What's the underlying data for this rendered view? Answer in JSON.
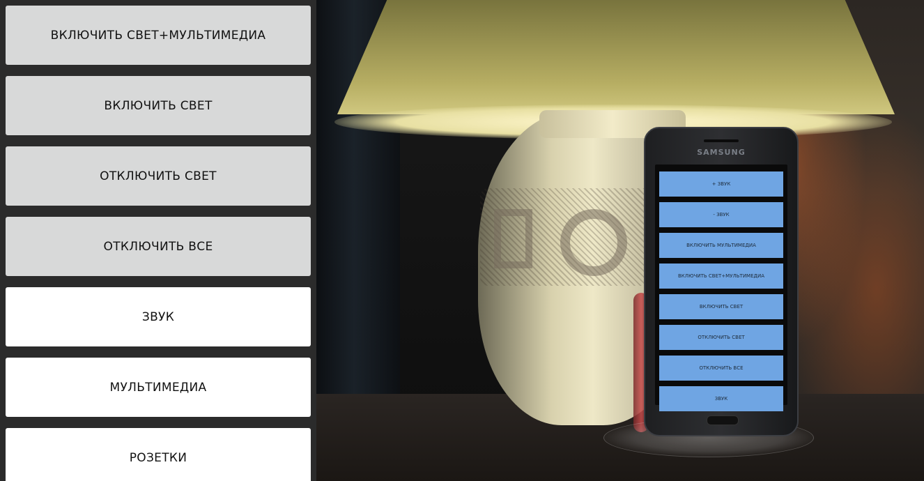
{
  "panel": {
    "buttons": [
      {
        "label": "ВКЛЮЧИТЬ СВЕТ+МУЛЬТИМЕДИА",
        "style": "grey"
      },
      {
        "label": "ВКЛЮЧИТЬ СВЕТ",
        "style": "grey"
      },
      {
        "label": "ОТКЛЮЧИТЬ СВЕТ",
        "style": "grey"
      },
      {
        "label": "ОТКЛЮЧИТЬ ВСЕ",
        "style": "grey"
      },
      {
        "label": "ЗВУК",
        "style": "white"
      },
      {
        "label": "МУЛЬТИМЕДИА",
        "style": "white"
      },
      {
        "label": "РОЗЕТКИ",
        "style": "white"
      }
    ]
  },
  "photo": {
    "phone": {
      "brand": "SAMSUNG",
      "screen_buttons": [
        "+ ЗВУК",
        "- ЗВУК",
        "ВКЛЮЧИТЬ МУЛЬТИМЕДИА",
        "ВКЛЮЧИТЬ СВЕТ+МУЛЬТИМЕДИА",
        "ВКЛЮЧИТЬ СВЕТ",
        "ОТКЛЮЧИТЬ СВЕТ",
        "ОТКЛЮЧИТЬ ВСЕ",
        "ЗВУК"
      ]
    }
  },
  "colors": {
    "panel_bg": "#2b2b2b",
    "button_grey": "#d8d9d9",
    "button_white": "#ffffff",
    "phone_button": "#6fa5e3"
  }
}
